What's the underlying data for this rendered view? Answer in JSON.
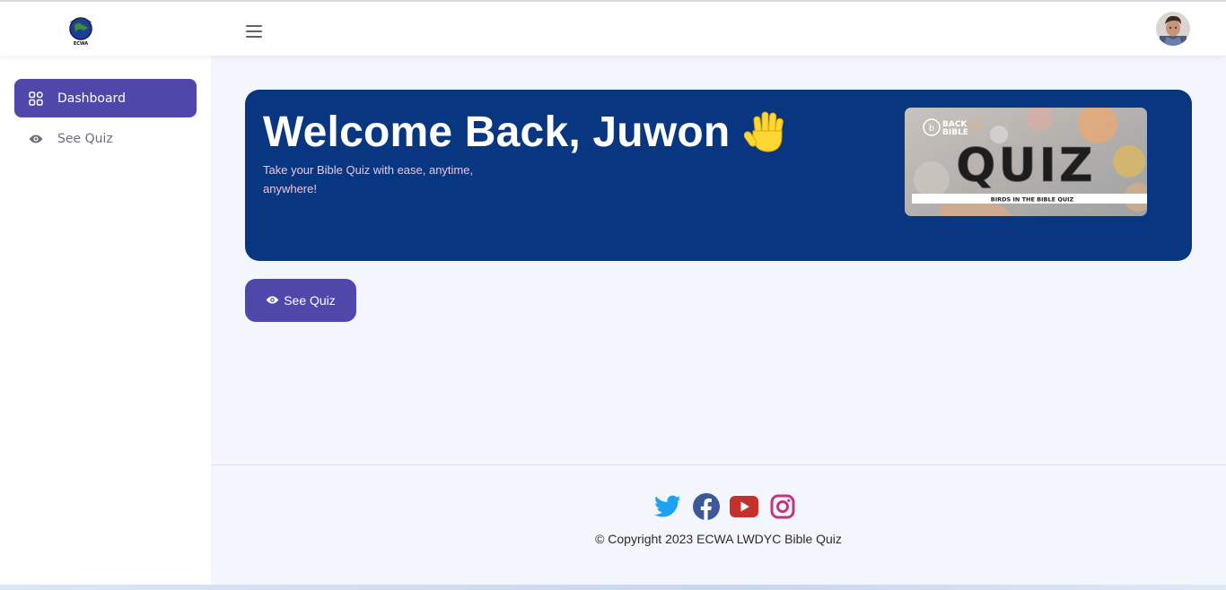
{
  "header": {
    "logo_text": "ECWA",
    "menu_icon": "hamburger-icon",
    "avatar_icon": "user-avatar"
  },
  "sidebar": {
    "items": [
      {
        "label": "Dashboard",
        "icon": "grid-icon",
        "active": true
      },
      {
        "label": "See Quiz",
        "icon": "eye-icon",
        "active": false
      }
    ]
  },
  "banner": {
    "title": "Welcome Back, Juwon",
    "subtitle": "Take your Bible Quiz with ease, anytime, anywhere!",
    "emoji_icon": "waving-hand-icon",
    "image": {
      "brand_line1": "BACK",
      "brand_line2": "to the",
      "brand_line3": "BIBLE",
      "headline": "QUIZ",
      "caption": "BIRDS IN THE BIBLE QUIZ"
    }
  },
  "actions": {
    "see_quiz_label": "See Quiz"
  },
  "footer": {
    "socials": [
      "twitter-icon",
      "facebook-icon",
      "youtube-icon",
      "instagram-icon"
    ],
    "copyright": "© Copyright 2023 ECWA LWDYC Bible Quiz"
  },
  "colors": {
    "primary": "#5047ab",
    "banner": "#083680",
    "background": "#f3f6fd",
    "twitter": "#1da1f2",
    "facebook": "#3b5998",
    "youtube": "#c4302b",
    "instagram": "#c13584"
  }
}
